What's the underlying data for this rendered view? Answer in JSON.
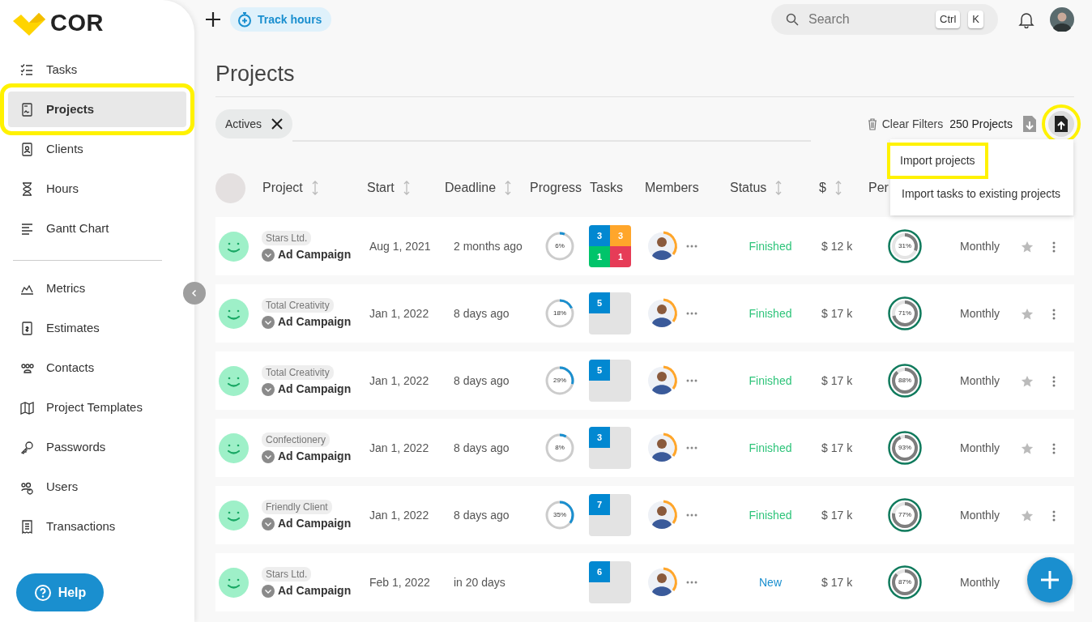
{
  "logo": {
    "text": "COR"
  },
  "nav": {
    "primary": [
      {
        "label": "Tasks",
        "selected": false,
        "highlighted": false
      },
      {
        "label": "Projects",
        "selected": true,
        "highlighted": true
      },
      {
        "label": "Clients",
        "selected": false,
        "highlighted": false
      },
      {
        "label": "Hours",
        "selected": false,
        "highlighted": false
      },
      {
        "label": "Gantt Chart",
        "selected": false,
        "highlighted": false
      }
    ],
    "secondary": [
      {
        "label": "Metrics",
        "selected": false,
        "highlighted": false
      },
      {
        "label": "Estimates",
        "selected": false,
        "highlighted": false
      },
      {
        "label": "Contacts",
        "selected": false,
        "highlighted": false
      },
      {
        "label": "Project Templates",
        "selected": false,
        "highlighted": false
      },
      {
        "label": "Passwords",
        "selected": false,
        "highlighted": false
      },
      {
        "label": "Users",
        "selected": false,
        "highlighted": false
      },
      {
        "label": "Transactions",
        "selected": false,
        "highlighted": false
      }
    ]
  },
  "help_button": "Help",
  "topbar": {
    "track_hours": "Track hours",
    "search": {
      "placeholder": "Search",
      "shortcut": [
        "Ctrl",
        "K"
      ]
    }
  },
  "page_title": "Projects",
  "filters": [
    {
      "label": "Actives"
    }
  ],
  "toolbar": {
    "clear_filters": "Clear Filters",
    "count": "250 Projects",
    "import_highlighted": true
  },
  "import_menu": [
    {
      "label": "Import projects",
      "highlighted": true
    },
    {
      "label": "Import tasks to existing projects",
      "highlighted": false
    }
  ],
  "table": {
    "columns": [
      {
        "label": "Project",
        "sortable": true
      },
      {
        "label": "Start",
        "sortable": true
      },
      {
        "label": "Deadline",
        "sortable": true
      },
      {
        "label": "Progress",
        "sortable": false
      },
      {
        "label": "Tasks",
        "sortable": false
      },
      {
        "label": "Members",
        "sortable": false
      },
      {
        "label": "Status",
        "sortable": true
      },
      {
        "label": "$",
        "sortable": true
      },
      {
        "label": "Per",
        "sortable": false
      }
    ],
    "rows": [
      {
        "client": "Stars Ltd.",
        "name": "Ad Campaign",
        "start": "Aug 1, 2021",
        "deadline": "2 months ago",
        "progress": {
          "level": 0.06,
          "label": "6%"
        },
        "tasks": [
          {
            "count": "3",
            "color": "#0288d1"
          },
          {
            "count": "3",
            "color": "#ffa62b"
          },
          {
            "count": "1",
            "color": "#00c46a"
          },
          {
            "count": "1",
            "color": "#e63c57"
          }
        ],
        "status": {
          "text": "Finished",
          "kind": "finished"
        },
        "amount": "$ 12 k",
        "performance": {
          "level": 0.31,
          "label": "31%"
        },
        "period": "Monthly",
        "actions": true
      },
      {
        "client": "Total Creativity",
        "name": "Ad Campaign",
        "start": "Jan 1, 2022",
        "deadline": "8 days ago",
        "progress": {
          "level": 0.18,
          "label": "18%"
        },
        "tasks": [
          {
            "count": "5",
            "color": "#0288d1"
          }
        ],
        "status": {
          "text": "Finished",
          "kind": "finished"
        },
        "amount": "$ 17 k",
        "performance": {
          "level": 0.71,
          "label": "71%"
        },
        "period": "Monthly",
        "actions": true
      },
      {
        "client": "Total Creativity",
        "name": "Ad Campaign",
        "start": "Jan 1, 2022",
        "deadline": "8 days ago",
        "progress": {
          "level": 0.29,
          "label": "29%"
        },
        "tasks": [
          {
            "count": "5",
            "color": "#0288d1"
          }
        ],
        "status": {
          "text": "Finished",
          "kind": "finished"
        },
        "amount": "$ 17 k",
        "performance": {
          "level": 0.88,
          "label": "88%"
        },
        "period": "Monthly",
        "actions": true
      },
      {
        "client": "Confectionery",
        "name": "Ad Campaign",
        "start": "Jan 1, 2022",
        "deadline": "8 days ago",
        "progress": {
          "level": 0.08,
          "label": "8%"
        },
        "tasks": [
          {
            "count": "3",
            "color": "#0288d1"
          }
        ],
        "status": {
          "text": "Finished",
          "kind": "finished"
        },
        "amount": "$ 17 k",
        "performance": {
          "level": 0.93,
          "label": "93%"
        },
        "period": "Monthly",
        "actions": true
      },
      {
        "client": "Friendly Client",
        "name": "Ad Campaign",
        "start": "Jan 1, 2022",
        "deadline": "8 days ago",
        "progress": {
          "level": 0.35,
          "label": "35%"
        },
        "tasks": [
          {
            "count": "7",
            "color": "#0288d1"
          }
        ],
        "status": {
          "text": "Finished",
          "kind": "finished"
        },
        "amount": "$ 17 k",
        "performance": {
          "level": 0.77,
          "label": "77%"
        },
        "period": "Monthly",
        "actions": true
      },
      {
        "client": "Stars Ltd.",
        "name": "Ad Campaign",
        "start": "Feb 1, 2022",
        "deadline": "in 20 days",
        "tasks": [
          {
            "count": "6",
            "color": "#0288d1"
          }
        ],
        "status": {
          "text": "New",
          "kind": "new"
        },
        "amount": "$ 17 k",
        "performance": {
          "level": 0.87,
          "label": "87%"
        },
        "period": "Monthly",
        "actions": false
      }
    ]
  }
}
